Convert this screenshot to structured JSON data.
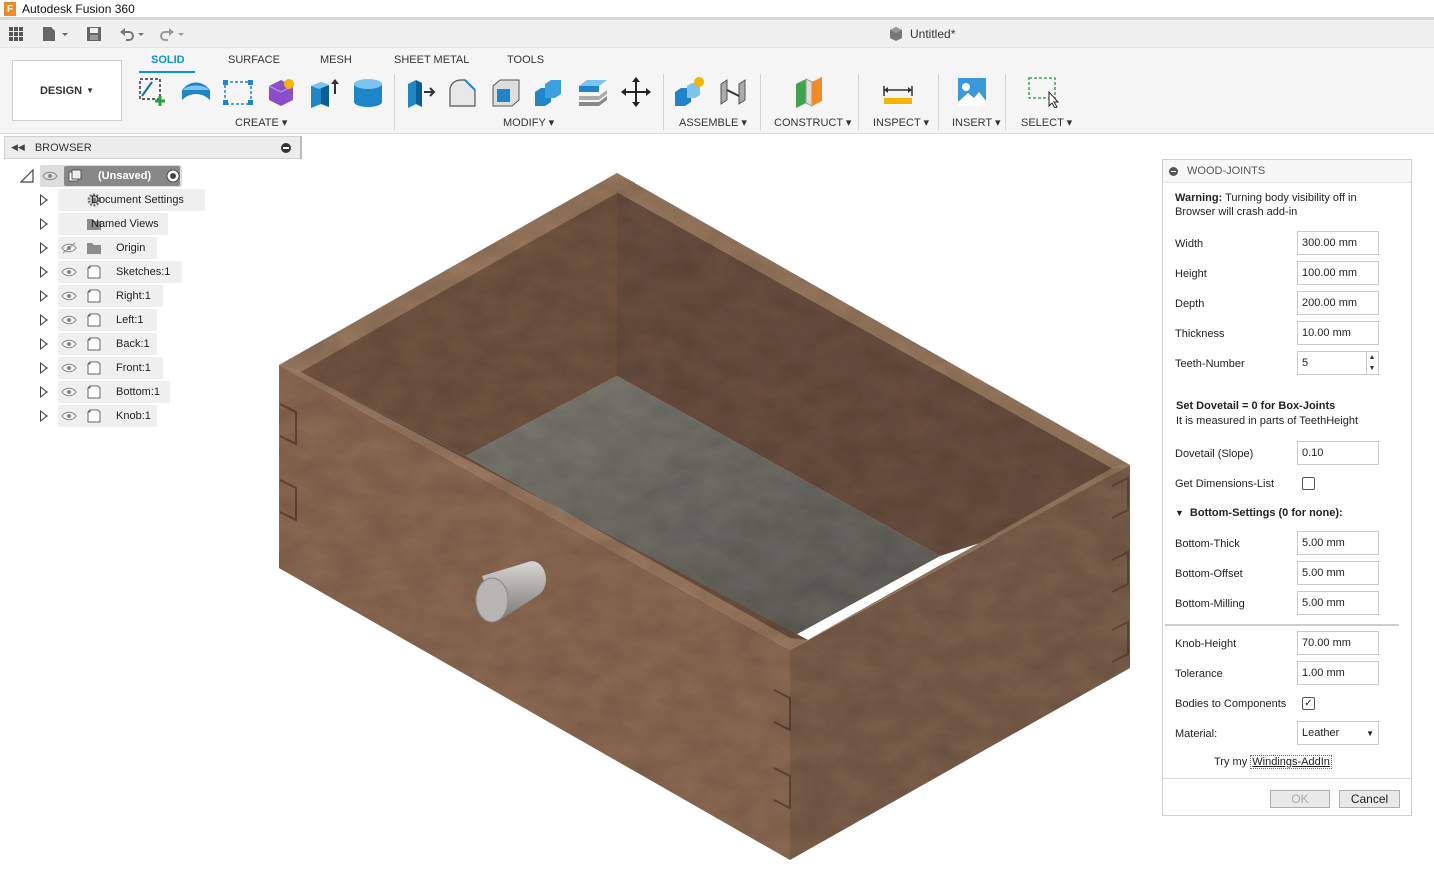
{
  "app": {
    "title": "Autodesk Fusion 360",
    "logo_letter": "F"
  },
  "document": {
    "title": "Untitled*"
  },
  "workspace": {
    "label": "DESIGN"
  },
  "tabs": [
    {
      "label": "SOLID"
    },
    {
      "label": "SURFACE"
    },
    {
      "label": "MESH"
    },
    {
      "label": "SHEET METAL"
    },
    {
      "label": "TOOLS"
    }
  ],
  "groups": {
    "create": "CREATE",
    "modify": "MODIFY",
    "assemble": "ASSEMBLE",
    "construct": "CONSTRUCT",
    "inspect": "INSPECT",
    "insert": "INSERT",
    "select": "SELECT"
  },
  "browser": {
    "title": "BROWSER",
    "root": "(Unsaved)",
    "items": [
      {
        "label": "Document Settings",
        "icon": "gear-icon"
      },
      {
        "label": "Named Views",
        "icon": "folder-icon"
      },
      {
        "label": "Origin",
        "icon": "folder-icon"
      },
      {
        "label": "Sketches:1",
        "icon": "body-icon"
      },
      {
        "label": "Right:1",
        "icon": "body-icon"
      },
      {
        "label": "Left:1",
        "icon": "body-icon"
      },
      {
        "label": "Back:1",
        "icon": "body-icon"
      },
      {
        "label": "Front:1",
        "icon": "body-icon"
      },
      {
        "label": "Bottom:1",
        "icon": "body-icon"
      },
      {
        "label": "Knob:1",
        "icon": "body-icon"
      }
    ]
  },
  "dialog": {
    "title": "WOOD-JOINTS",
    "warning_bold": "Warning:",
    "warning_text": "Turning body visibility off in Browser will crash add-in",
    "fields": {
      "width": {
        "label": "Width",
        "value": "300.00 mm"
      },
      "height": {
        "label": "Height",
        "value": "100.00 mm"
      },
      "depth": {
        "label": "Depth",
        "value": "200.00 mm"
      },
      "thickness": {
        "label": "Thickness",
        "value": "10.00 mm"
      },
      "teeth": {
        "label": "Teeth-Number",
        "value": "5"
      },
      "dovetail": {
        "label": "Dovetail (Slope)",
        "value": "0.10"
      },
      "dimlist": {
        "label": "Get Dimensions-List"
      },
      "bottom_thick": {
        "label": "Bottom-Thick",
        "value": "5.00 mm"
      },
      "bottom_offset": {
        "label": "Bottom-Offset",
        "value": "5.00 mm"
      },
      "bottom_milling": {
        "label": "Bottom-Milling",
        "value": "5.00 mm"
      },
      "knob_height": {
        "label": "Knob-Height",
        "value": "70.00 mm"
      },
      "tolerance": {
        "label": "Tolerance",
        "value": "1.00 mm"
      },
      "bodies": {
        "label": "Bodies to Components"
      },
      "material": {
        "label": "Material:",
        "value": "Leather"
      }
    },
    "dovetail_note_bold": "Set Dovetail = 0 for Box-Joints",
    "dovetail_note": "It is measured in parts of TeethHeight",
    "bottom_group": "Bottom-Settings (0 for none):",
    "try_prefix": "Try my",
    "try_link": "Windings-AddIn",
    "ok": "OK",
    "cancel": "Cancel"
  },
  "colors": {
    "accent": "#0696d7",
    "wood": "#8a6a54",
    "floor": "#6e6d66"
  }
}
